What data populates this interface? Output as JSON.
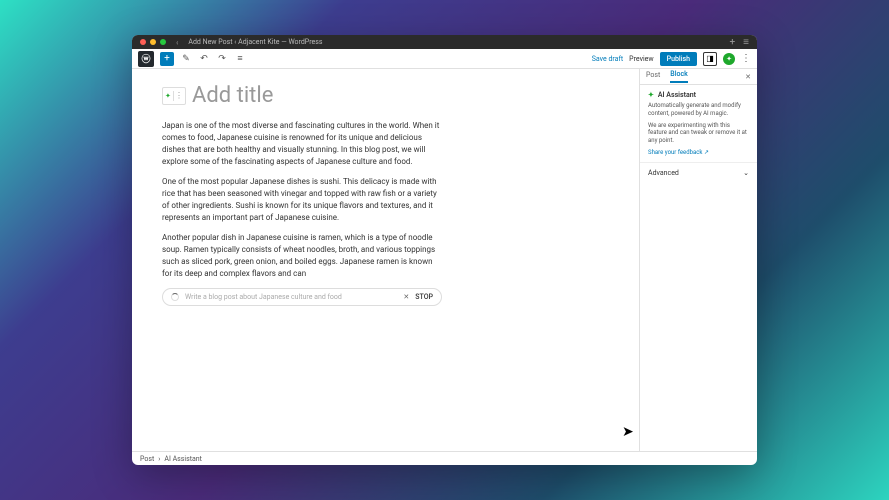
{
  "window_title": "Add New Post ‹ Adjacent Kite — WordPress",
  "toolbar": {
    "save_draft": "Save draft",
    "preview": "Preview",
    "publish": "Publish"
  },
  "editor": {
    "title_placeholder": "Add title",
    "paragraphs": [
      "Japan is one of the most diverse and fascinating cultures in the world. When it comes to food, Japanese cuisine is renowned for its unique and delicious dishes that are both healthy and visually stunning. In this blog post, we will explore some of the fascinating aspects of Japanese culture and food.",
      "One of the most popular Japanese dishes is sushi. This delicacy is made with rice that has been seasoned with vinegar and topped with raw fish or a variety of other ingredients. Sushi is known for its unique flavors and textures, and it represents an important part of Japanese cuisine.",
      "Another popular dish in Japanese cuisine is ramen, which is a type of noodle soup. Ramen typically consists of wheat noodles, broth, and various toppings such as sliced pork, green onion, and boiled eggs. Japanese ramen is known for its deep and complex flavors and can"
    ],
    "ai_prompt_placeholder": "Write a blog post about Japanese culture and food",
    "stop_label": "STOP"
  },
  "sidebar": {
    "tabs": {
      "post": "Post",
      "block": "Block"
    },
    "ai": {
      "title": "AI Assistant",
      "desc1": "Automatically generate and modify content, powered by AI magic.",
      "desc2": "We are experimenting with this feature and can tweak or remove it at any point.",
      "feedback": "Share your feedback ↗"
    },
    "advanced": "Advanced"
  },
  "footer": {
    "crumb1": "Post",
    "crumb2": "AI Assistant"
  }
}
